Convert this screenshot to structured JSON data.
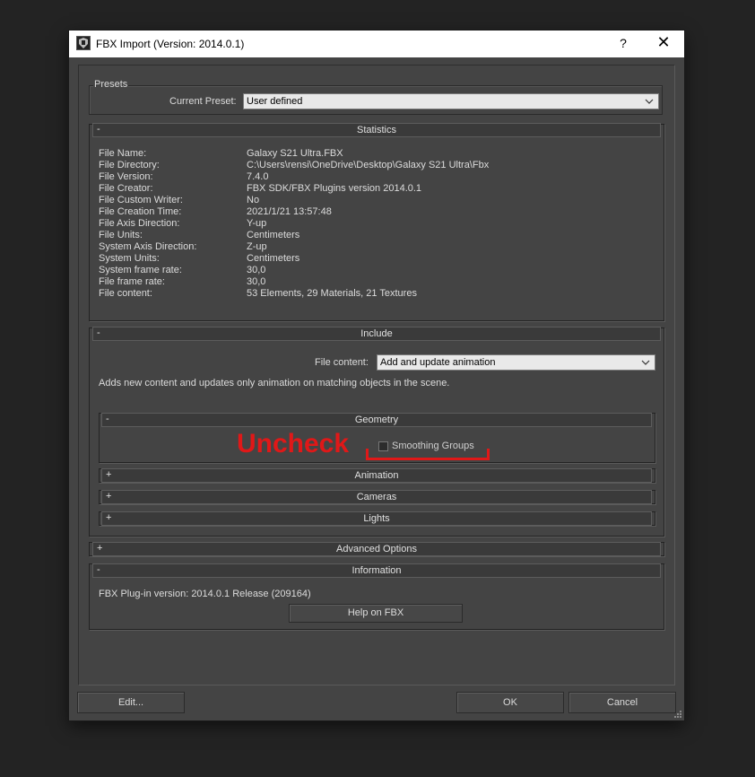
{
  "window": {
    "title": "FBX Import (Version: 2014.0.1)",
    "help": "?",
    "close": "✕"
  },
  "presets": {
    "group_label": "Presets",
    "current_label": "Current Preset:",
    "current_value": "User defined"
  },
  "statistics": {
    "header": "Statistics",
    "toggle": "-",
    "rows": [
      {
        "label": "File Name:",
        "value": "Galaxy S21 Ultra.FBX"
      },
      {
        "label": "File Directory:",
        "value": "C:\\Users\\rensi\\OneDrive\\Desktop\\Galaxy S21 Ultra\\Fbx"
      },
      {
        "label": "File Version:",
        "value": "7.4.0"
      },
      {
        "label": "File Creator:",
        "value": "FBX SDK/FBX Plugins version 2014.0.1"
      },
      {
        "label": "File Custom Writer:",
        "value": "No"
      },
      {
        "label": "File Creation Time:",
        "value": "2021/1/21  13:57:48"
      },
      {
        "label": "File Axis Direction:",
        "value": "Y-up"
      },
      {
        "label": "File Units:",
        "value": "Centimeters"
      },
      {
        "label": "System Axis Direction:",
        "value": "Z-up"
      },
      {
        "label": "System Units:",
        "value": "Centimeters"
      },
      {
        "label": "System frame rate:",
        "value": "30,0"
      },
      {
        "label": "File frame rate:",
        "value": "30,0"
      },
      {
        "label": "File content:",
        "value": "53 Elements,   29 Materials,   21 Textures"
      }
    ]
  },
  "include": {
    "header": "Include",
    "toggle": "-",
    "file_content_label": "File content:",
    "file_content_value": "Add and update animation",
    "description": "Adds new content and updates only animation on matching objects in the scene.",
    "geometry": {
      "header": "Geometry",
      "toggle": "-",
      "smoothing_label": "Smoothing Groups"
    },
    "animation": {
      "header": "Animation",
      "toggle": "+"
    },
    "cameras": {
      "header": "Cameras",
      "toggle": "+"
    },
    "lights": {
      "header": "Lights",
      "toggle": "+"
    }
  },
  "annotation": {
    "text": "Uncheck",
    "color": "#e01818"
  },
  "advanced": {
    "header": "Advanced Options",
    "toggle": "+"
  },
  "information": {
    "header": "Information",
    "toggle": "-",
    "plugin_version": "FBX Plug-in version: 2014.0.1 Release (209164)",
    "help_button": "Help on FBX"
  },
  "footer": {
    "edit": "Edit...",
    "ok": "OK",
    "cancel": "Cancel"
  }
}
